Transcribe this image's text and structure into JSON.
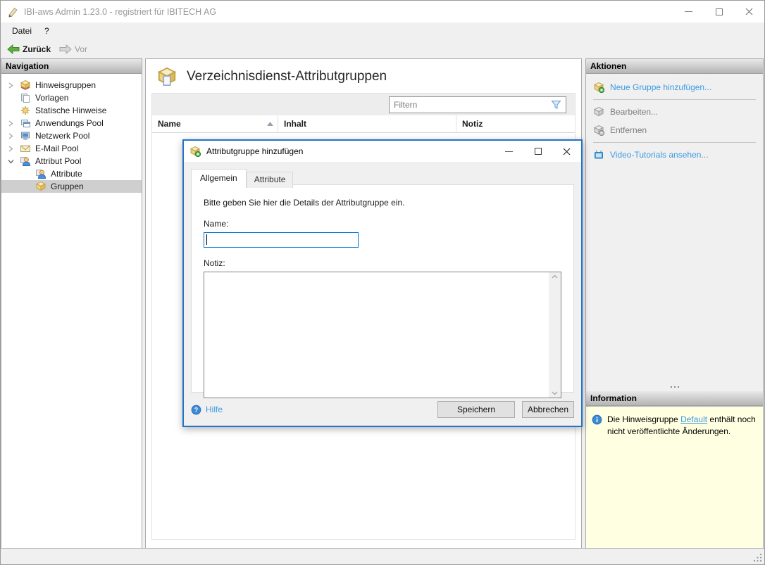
{
  "window": {
    "title": "IBI-aws Admin 1.23.0 - registriert für IBITECH AG"
  },
  "menu": {
    "items": [
      {
        "label": "Datei"
      },
      {
        "label": "?"
      }
    ]
  },
  "toolbar": {
    "back_label": "Zurück",
    "forward_label": "Vor"
  },
  "navigation": {
    "header": "Navigation",
    "items": [
      {
        "label": "Hinweisgruppen",
        "expanded": false,
        "icon": "notice-group-box-icon"
      },
      {
        "label": "Vorlagen",
        "expanded": null,
        "icon": "templates-pages-icon"
      },
      {
        "label": "Statische Hinweise",
        "expanded": null,
        "icon": "static-notices-gear-icon"
      },
      {
        "label": "Anwendungs Pool",
        "expanded": false,
        "icon": "application-windows-icon"
      },
      {
        "label": "Netzwerk Pool",
        "expanded": false,
        "icon": "network-monitor-icon"
      },
      {
        "label": "E-Mail Pool",
        "expanded": false,
        "icon": "email-envelope-icon"
      },
      {
        "label": "Attribut Pool",
        "expanded": true,
        "icon": "attribute-person-icon"
      },
      {
        "label": "Attribute",
        "expanded": null,
        "icon": "attribute-person-icon",
        "child": true
      },
      {
        "label": "Gruppen",
        "expanded": null,
        "icon": "group-box-icon",
        "child": true,
        "selected": true
      }
    ]
  },
  "main": {
    "title": "Verzeichnisdienst-Attributgruppen",
    "filter": {
      "placeholder": "Filtern"
    },
    "table": {
      "columns": [
        "Name",
        "Inhalt",
        "Notiz"
      ],
      "sort": {
        "column": "Name",
        "direction": "ascending"
      },
      "rows": []
    }
  },
  "actions": {
    "header": "Aktionen",
    "items": [
      {
        "label": "Neue Gruppe hinzufügen...",
        "enabled": true,
        "icon": "add-group-box-plus-icon"
      },
      {
        "label": "Bearbeiten...",
        "enabled": false,
        "icon": "edit-box-gray-icon"
      },
      {
        "label": "Entfernen",
        "enabled": false,
        "icon": "remove-box-minus-icon"
      },
      {
        "label": "Video-Tutorials ansehen...",
        "enabled": true,
        "icon": "video-tv-icon"
      }
    ]
  },
  "information": {
    "header": "Information",
    "message_before": "Die Hinweisgruppe ",
    "message_link": "Default",
    "message_after": " enthält noch nicht veröffentlichte Änderungen."
  },
  "dialog": {
    "title": "Attributgruppe hinzufügen",
    "tabs": [
      {
        "label": "Allgemein",
        "active": true
      },
      {
        "label": "Attribute",
        "active": false
      }
    ],
    "instruction": "Bitte geben Sie hier die Details der Attributgruppe ein.",
    "fields": {
      "name": {
        "label": "Name:",
        "value": ""
      },
      "notiz": {
        "label": "Notiz:",
        "value": ""
      }
    },
    "help_label": "Hilfe",
    "buttons": {
      "save": "Speichern",
      "cancel": "Abbrechen"
    }
  },
  "colors": {
    "dialog_border_blue": "#2373c8",
    "focus_border_blue": "#0078d7",
    "link_blue": "#3d9ae1",
    "info_panel_yellow": "#ffffe1",
    "selection_gray": "#cfcfcf",
    "back_arrow_green": "#5fae43"
  }
}
